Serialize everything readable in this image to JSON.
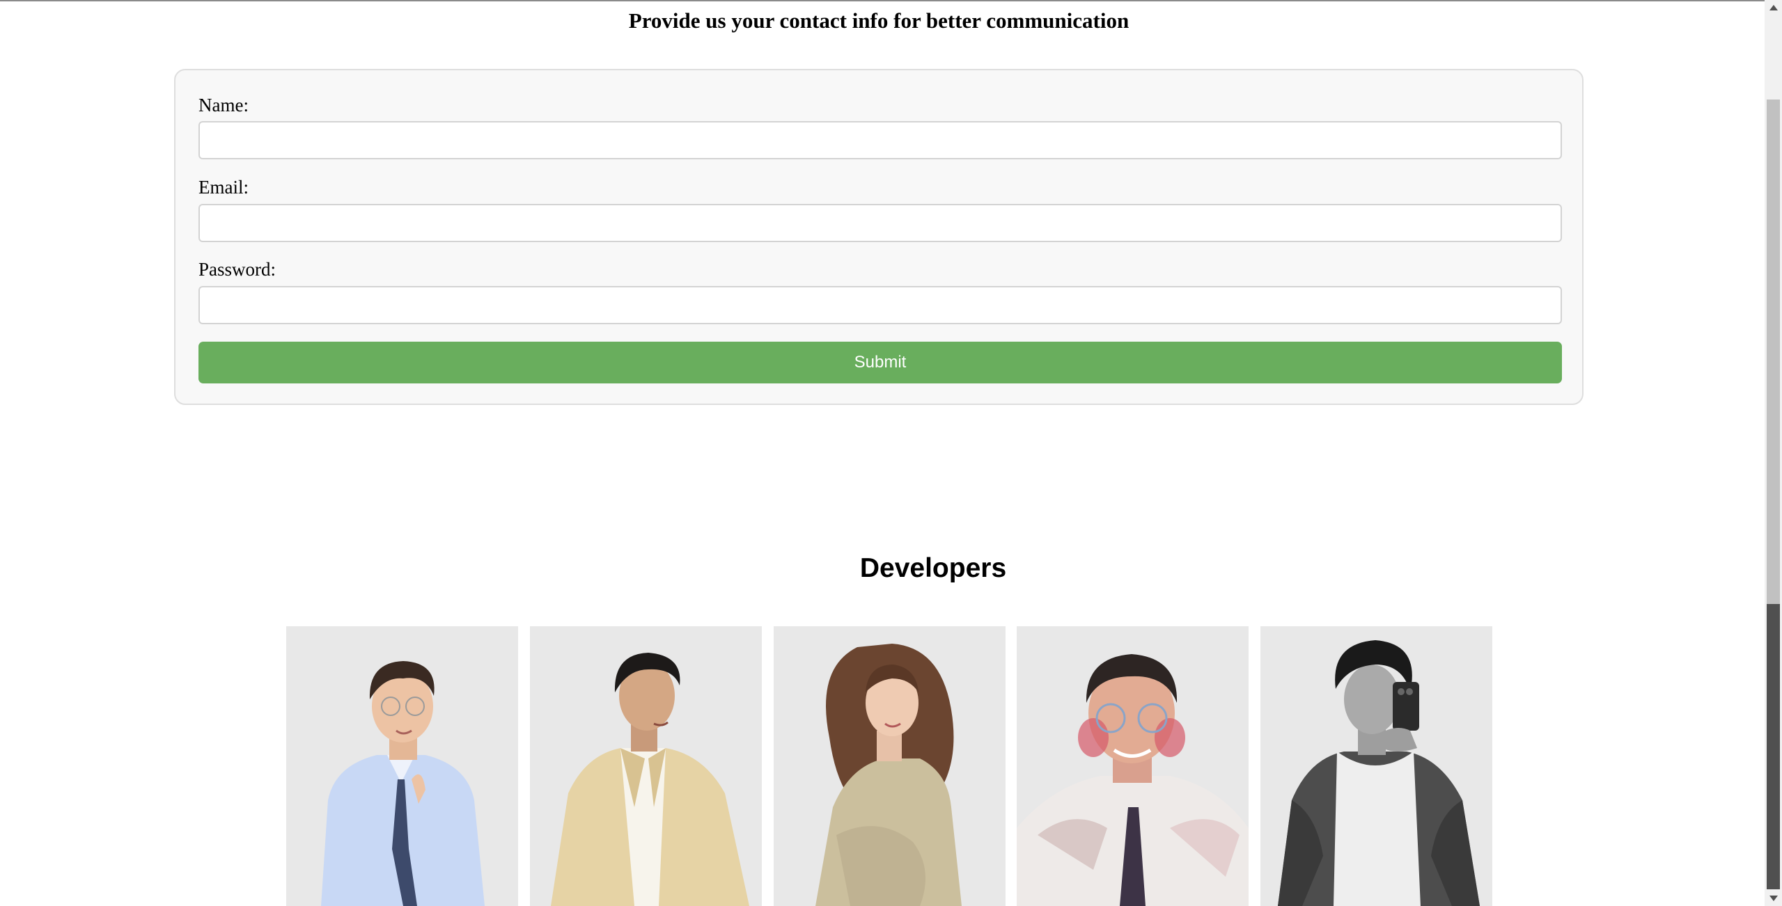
{
  "contact": {
    "heading": "Provide us your contact info for better communication",
    "name_label": "Name:",
    "email_label": "Email:",
    "password_label": "Password:",
    "submit_label": "Submit"
  },
  "developers": {
    "heading": "Developers",
    "cards": [
      "developer-1",
      "developer-2",
      "developer-3",
      "developer-4",
      "developer-5"
    ]
  },
  "colors": {
    "submit_bg": "#69ae5d",
    "card_bg": "#e8e8e8",
    "form_bg": "#f8f8f8"
  }
}
